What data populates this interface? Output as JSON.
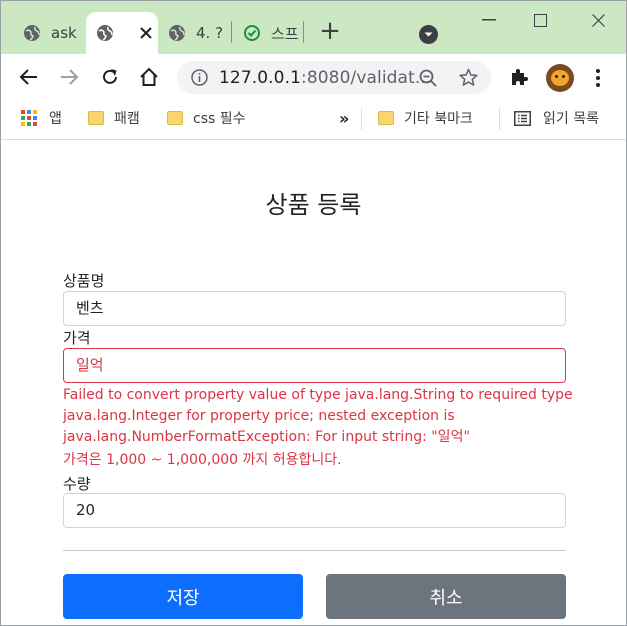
{
  "browser": {
    "tabs": [
      {
        "label": "ask",
        "active": false
      },
      {
        "label": "",
        "active": true
      },
      {
        "label": "4. ?",
        "active": false
      },
      {
        "label": "스프",
        "active": false
      }
    ],
    "url_host": "127.0.0.1",
    "url_rest": ":8080/validat...",
    "bookmarks": [
      {
        "label": "앱",
        "icon": "apps-grid-icon"
      },
      {
        "label": "패캠",
        "icon": "folder-icon"
      },
      {
        "label": "css 필수",
        "icon": "folder-icon"
      },
      {
        "label": "기타 북마크",
        "icon": "folder-icon"
      },
      {
        "label": "읽기 목록",
        "icon": "reading-list-icon"
      }
    ],
    "overflow_chevron": "»"
  },
  "form": {
    "title": "상품 등록",
    "name_label": "상품명",
    "name_value": "벤츠",
    "price_label": "가격",
    "price_value": "일억",
    "price_error_1": "Failed to convert property value of type java.lang.String to required type java.lang.Integer for property price; nested exception is java.lang.NumberFormatException: For input string: \"일억\"",
    "price_error_2": "가격은 1,000 ~ 1,000,000 까지 허용합니다.",
    "quantity_label": "수량",
    "quantity_value": "20",
    "save_button": "저장",
    "cancel_button": "취소"
  },
  "colors": {
    "tabstrip": "#cce8c2",
    "primary": "#0d6efd",
    "secondary": "#6c757d",
    "danger": "#dc3545"
  }
}
